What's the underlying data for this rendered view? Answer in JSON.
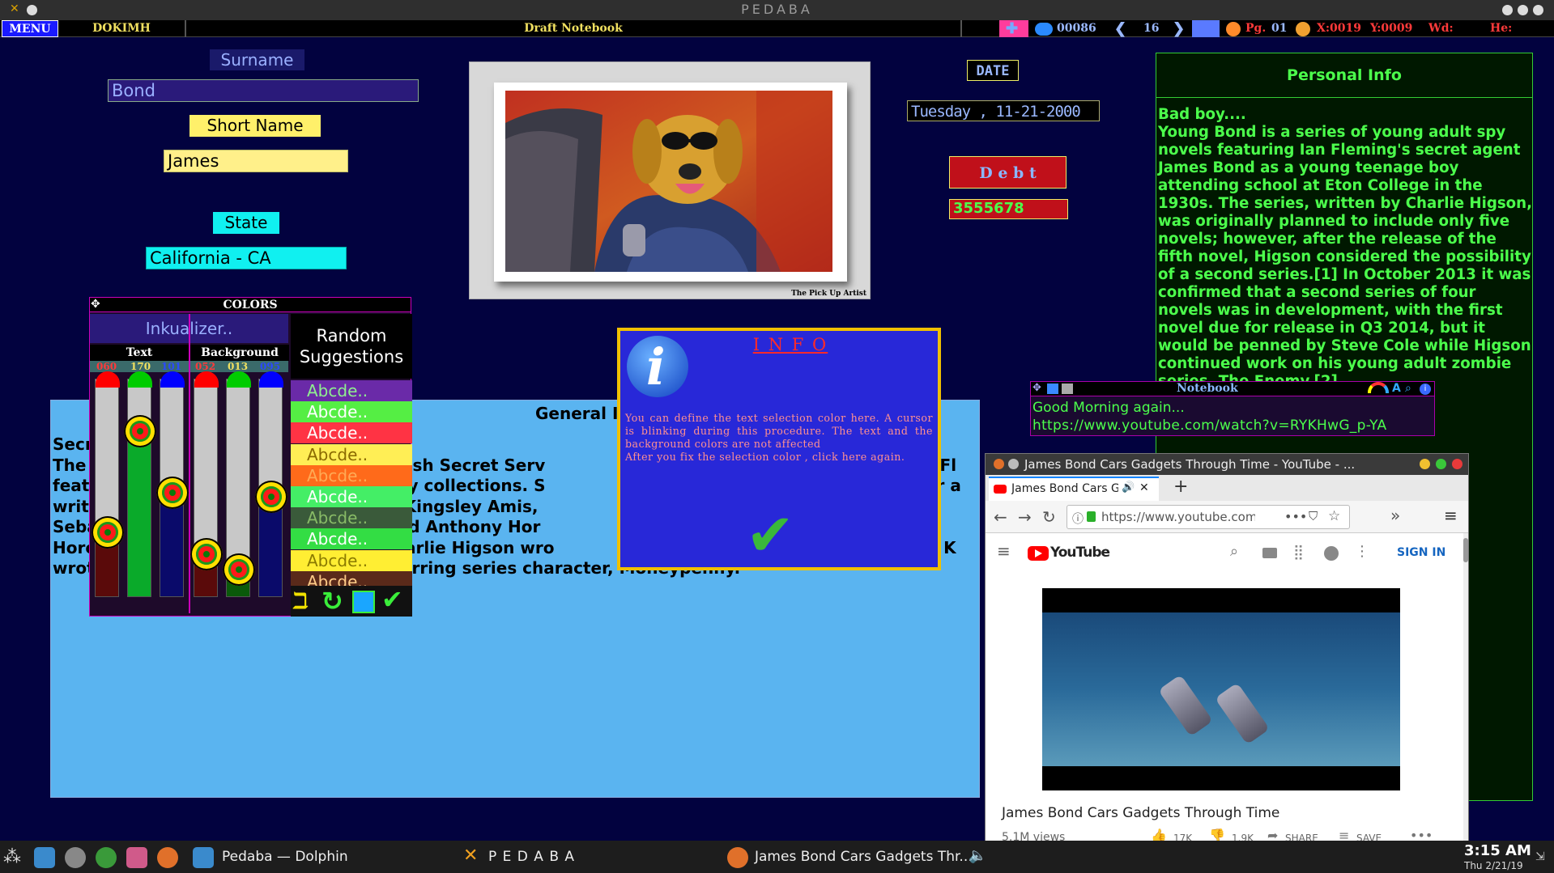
{
  "window": {
    "title": "PEDABA"
  },
  "menubar": {
    "menu": "MENU",
    "app": "DOKIMH",
    "doc_title": "Draft Notebook",
    "counter": "00086",
    "page_num": "16",
    "pg_label": "Pg.",
    "pg_value": "01",
    "x_coord": "X:0019",
    "y_coord": "Y:0009",
    "wd_label": "Wd:",
    "he_label": "He:"
  },
  "form": {
    "surname_label": "Surname",
    "surname_value": "Bond",
    "shortname_label": "Short Name",
    "shortname_value": "James",
    "state_label": "State",
    "state_value": "California  -  CA",
    "date_label": "DATE",
    "date_value": "Tuesday  ,  11-21-2000",
    "debt_label": "D e b t",
    "debt_value": "3555678"
  },
  "picture": {
    "caption": "The Pick Up Artist"
  },
  "colors_panel": {
    "title": "COLORS",
    "preset": "Inkualizer..",
    "text_label": "Text",
    "background_label": "Background",
    "text_rgb": [
      "060",
      "170",
      "101"
    ],
    "bg_rgb": [
      "052",
      "013",
      "095"
    ],
    "text_levels": [
      0.22,
      0.68,
      0.4
    ],
    "bg_levels": [
      0.12,
      0.05,
      0.38
    ],
    "random_label": "Random\nSuggestions",
    "suggestions": [
      {
        "text": "Abcde..",
        "bg": "#6a2aa8",
        "fg": "#8ff08f"
      },
      {
        "text": "Abcde..",
        "bg": "#55ee44",
        "fg": "#ffffff"
      },
      {
        "text": "Abcde..",
        "bg": "#ff3344",
        "fg": "#ffffff"
      },
      {
        "text": "Abcde..",
        "bg": "#ffee55",
        "fg": "#8a6a00"
      },
      {
        "text": "Abcde..",
        "bg": "#ff6a1a",
        "fg": "#ffaa55"
      },
      {
        "text": "Abcde..",
        "bg": "#44ee66",
        "fg": "#ffffff"
      },
      {
        "text": "Abcde..",
        "bg": "#3a5a3a",
        "fg": "#88bb66"
      },
      {
        "text": "Abcde..",
        "bg": "#33dd44",
        "fg": "#ffffff"
      },
      {
        "text": "Abcde..",
        "bg": "#ffee33",
        "fg": "#8a7a00"
      },
      {
        "text": "Abcde..",
        "bg": "#5a2a1a",
        "fg": "#ffcc88"
      }
    ]
  },
  "general_info": {
    "title": "General Info",
    "lines": [
      "Secr",
      "The                                           onal British Secret Serv                                                                 an Fl",
      "feat                                          hort-story collections. S                                                                ther a",
      "writ                                          zations: Kingsley Amis,                                                               ymor",
      "Seba                                          Boyd and Anthony Hor                                                              nd a l",
      "Horc                                          nally Charlie Higson wro                                                              and K",
      "wrot                                          of a recurring series character, Moneypenny."
    ]
  },
  "info_dialog": {
    "title": "I N F O",
    "body": "You can define the text selection color here. A cursor is blinking during this procedure. The text and the background colors are not affected\nAfter you fix the selection color , click here again."
  },
  "personal_info": {
    "title": "Personal Info",
    "text": "Bad boy....\nYoung Bond is a series of young adult spy novels featuring Ian Fleming's secret agent James Bond as a young teenage boy attending school at Eton College in the 1930s. The series, written by Charlie Higson, was originally planned to include only five novels; however, after the release of the fifth novel, Higson considered the possibility of a second series.[1] In October 2013 it was confirmed that a second series of four novels was in development, with the first novel due for release in Q3 2014, but it would be penned by Steve Cole while Higson continued work on his young adult zombie series, The Enemy.[2]"
  },
  "notebook": {
    "title": "Notebook",
    "line1": "Good Morning again...",
    "line2": "https://www.youtube.com/watch?v=RYKHwG_p-YA"
  },
  "browser": {
    "window_title": "James Bond Cars Gadgets Through Time - YouTube - ...",
    "tab_title": "James Bond Cars Ga",
    "url": "https://www.youtube.com/watch",
    "brand": "YouTube",
    "sign_in": "SIGN IN",
    "video_title": "James Bond Cars Gadgets Through Time",
    "views": "5.1M views",
    "likes": "17K",
    "dislikes": "1.9K",
    "share": "SHARE",
    "save": "SAVE"
  },
  "taskbar": {
    "dolphin": "Pedaba — Dolphin",
    "pedaba": "P E D A B A",
    "firefox": "James Bond Cars Gadgets Thr...",
    "clock_time": "3:15 AM",
    "clock_date": "Thu 2/21/19"
  }
}
